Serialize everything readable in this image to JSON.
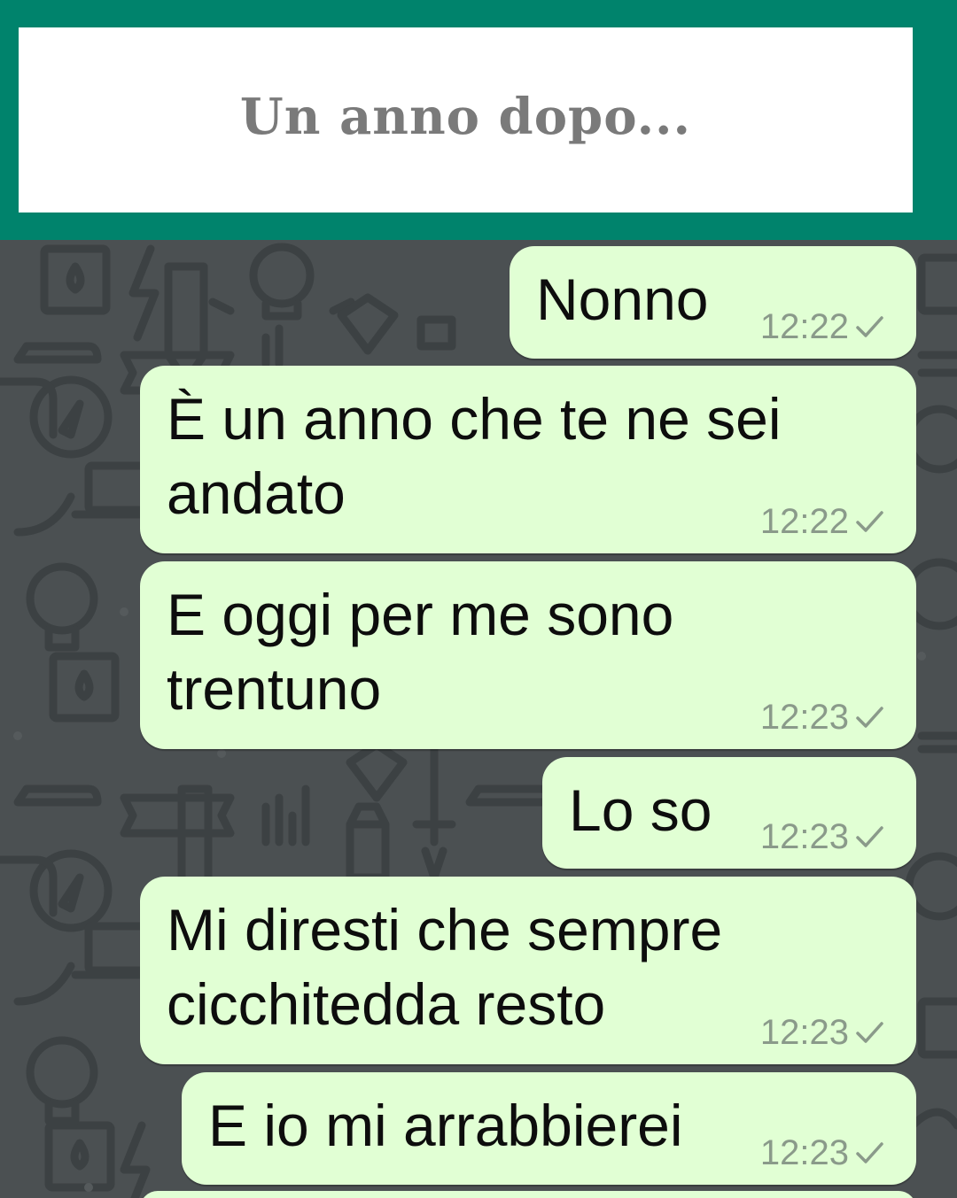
{
  "header": {
    "title": "Un anno dopo..."
  },
  "messages": [
    {
      "text": "Nonno",
      "time": "12:22",
      "status_icon": "sent-check-icon"
    },
    {
      "text_line1": "È un anno che te ne sei",
      "text_line2": "andato",
      "time": "12:22",
      "status_icon": "sent-check-icon"
    },
    {
      "text_line1": "E oggi per me sono",
      "text_line2": "trentuno",
      "time": "12:23",
      "status_icon": "sent-check-icon"
    },
    {
      "text": "Lo so",
      "time": "12:23",
      "status_icon": "sent-check-icon"
    },
    {
      "text_line1": "Mi diresti che sempre",
      "text_line2": "cicchitedda resto",
      "time": "12:23",
      "status_icon": "sent-check-icon"
    },
    {
      "text": "E io mi arrabbierei",
      "time": "12:23",
      "status_icon": "sent-check-icon"
    }
  ],
  "colors": {
    "header_band": "#00836c",
    "bubble_outgoing": "#e1ffd4",
    "wallpaper": "#4b5052",
    "title_text": "#7a7a7a"
  }
}
